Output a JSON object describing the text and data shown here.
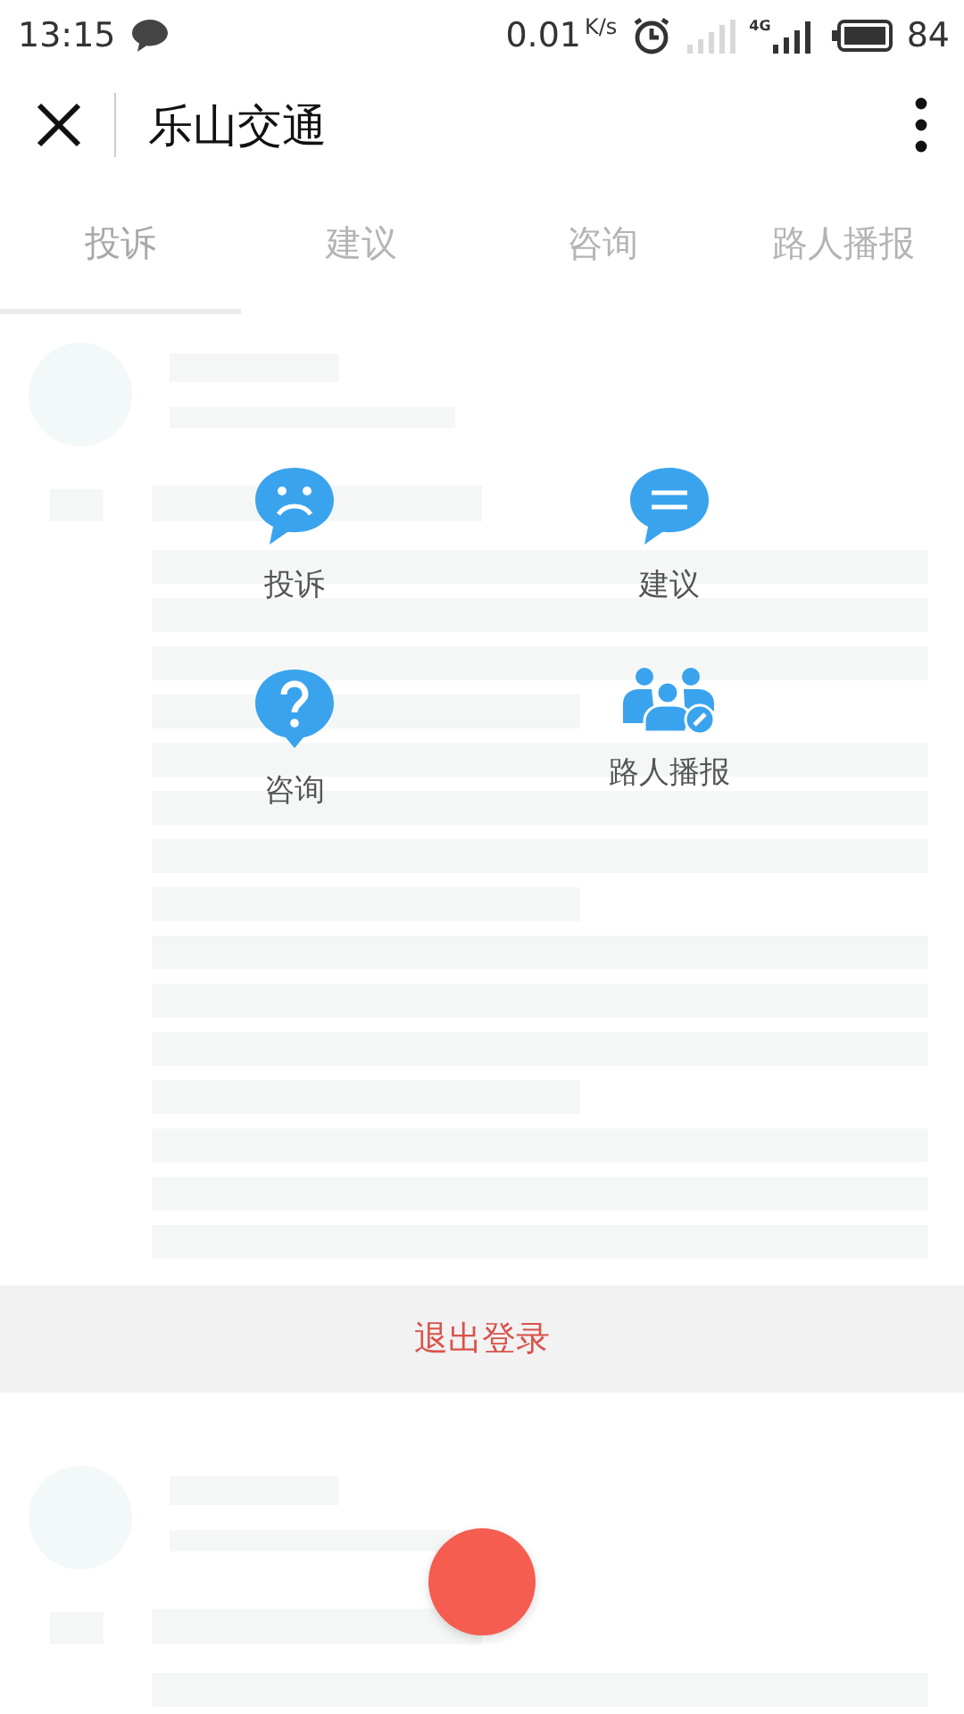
{
  "status_bar": {
    "time": "13:15",
    "net_speed": "0.01",
    "speed_unit": "K/s",
    "network": "4G",
    "battery": "84"
  },
  "header": {
    "title": "乐山交通"
  },
  "tabs": [
    {
      "label": "投诉",
      "selected": true
    },
    {
      "label": "建议",
      "selected": false
    },
    {
      "label": "咨询",
      "selected": false
    },
    {
      "label": "路人播报",
      "selected": false
    }
  ],
  "menu": [
    {
      "label": "投诉",
      "kind": "sad"
    },
    {
      "label": "建议",
      "kind": "lines"
    },
    {
      "label": "咨询",
      "kind": "question"
    },
    {
      "label": "路人播报",
      "kind": "people"
    }
  ],
  "logout": {
    "label": "退出登录"
  }
}
